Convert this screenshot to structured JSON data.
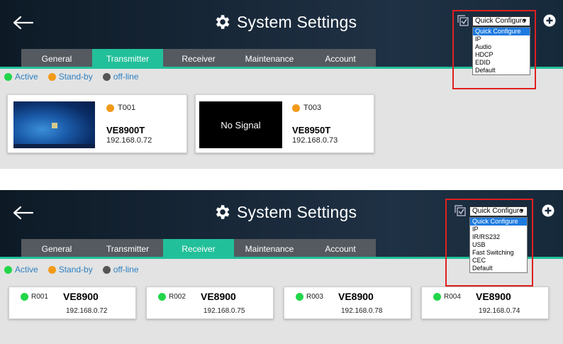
{
  "title": "System Settings",
  "colors": {
    "accent": "#22c09a",
    "active": "#22d64a",
    "standby": "#f19a1a",
    "offline": "#555555",
    "highlight": "#e02020"
  },
  "legend": {
    "active": "Active",
    "standby": "Stand-by",
    "offline": "off-line"
  },
  "top_panel": {
    "tabs": [
      "General",
      "Transmitter",
      "Receiver",
      "Maintenance",
      "Account"
    ],
    "active_tab": "Transmitter",
    "quick_configure": {
      "selected": "Quick Configure",
      "options": [
        "Quick Configure",
        "IP",
        "Audio",
        "HDCP",
        "EDID",
        "Default"
      ]
    },
    "transmitters": [
      {
        "id": "T001",
        "status": "standby",
        "model": "VE8900T",
        "ip": "192.168.0.72",
        "preview": "desktop"
      },
      {
        "id": "T003",
        "status": "standby",
        "model": "VE8950T",
        "ip": "192.168.0.73",
        "preview": "No Signal"
      }
    ]
  },
  "bottom_panel": {
    "tabs": [
      "General",
      "Transmitter",
      "Receiver",
      "Maintenance",
      "Account"
    ],
    "active_tab": "Receiver",
    "quick_configure": {
      "selected": "Quick Configure",
      "options": [
        "Quick Configure",
        "IP",
        "IR/RS232",
        "USB",
        "Fast Switching",
        "CEC",
        "Default"
      ]
    },
    "receivers": [
      {
        "id": "R001",
        "status": "active",
        "model": "VE8900",
        "ip": "192.168.0.72"
      },
      {
        "id": "R002",
        "status": "active",
        "model": "VE8900",
        "ip": "192.168.0.75"
      },
      {
        "id": "R003",
        "status": "active",
        "model": "VE8900",
        "ip": "192.168.0.78"
      },
      {
        "id": "R004",
        "status": "active",
        "model": "VE8900",
        "ip": "192.168.0.74"
      }
    ]
  },
  "icons": {
    "back": "back-arrow-icon",
    "settings": "gear-icon",
    "configure": "quick-configure-icon",
    "add": "add-circle-icon"
  }
}
